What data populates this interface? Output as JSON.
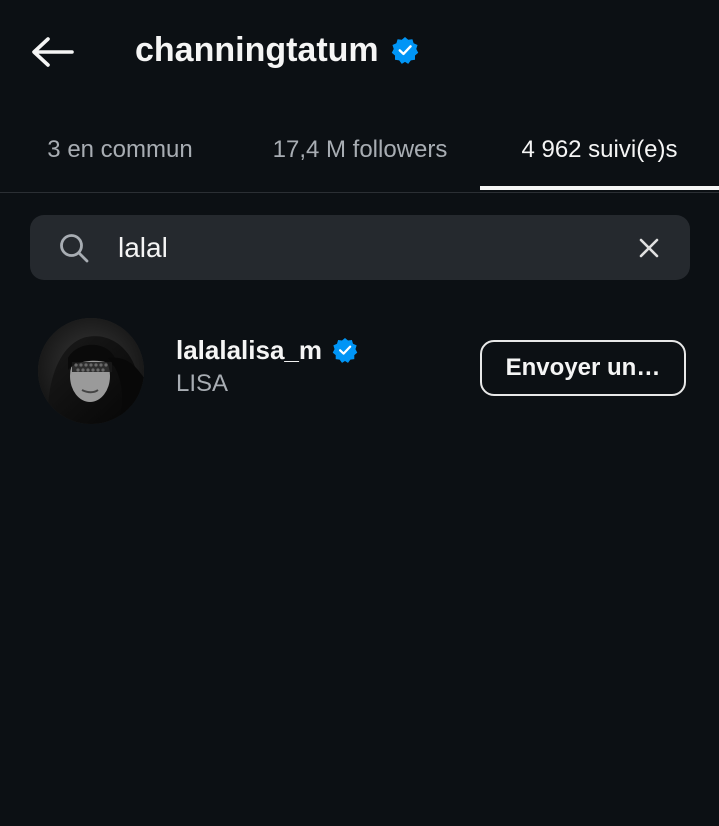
{
  "header": {
    "title": "channingtatum",
    "back_icon": "arrow-left-icon",
    "verified_icon": "verified-badge-icon"
  },
  "tabs": [
    {
      "label": "3 en commun",
      "active": false
    },
    {
      "label": "17,4 M followers",
      "active": false
    },
    {
      "label": "4 962 suivi(e)s",
      "active": true
    }
  ],
  "search": {
    "value": "lalal",
    "icon": "search-icon",
    "clear_icon": "close-icon"
  },
  "results": [
    {
      "username": "lalalalisa_m",
      "full_name": "LISA",
      "verified": true,
      "button_label": "Envoyer un…"
    }
  ],
  "colors": {
    "background": "#0c1014",
    "search_bg": "#25292e",
    "verified_blue": "#0095f6",
    "secondary_text": "#a8adb3",
    "primary_text": "#f5f5f5"
  }
}
